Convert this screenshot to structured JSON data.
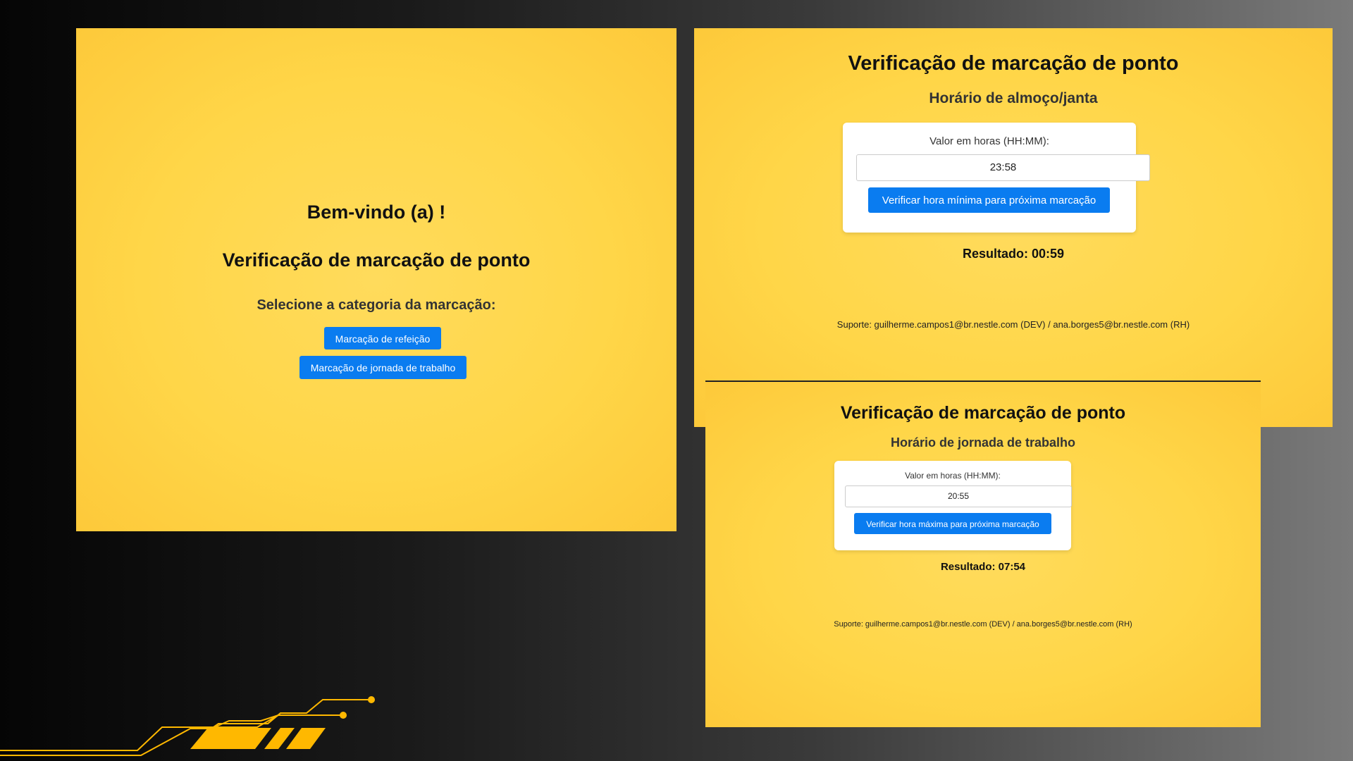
{
  "home": {
    "welcome": "Bem-vindo (a) !",
    "title": "Verificação de marcação de ponto",
    "subtitle": "Selecione a categoria da marcação:",
    "btn_refeicao": "Marcação de refeição",
    "btn_jornada": "Marcação de jornada de trabalho"
  },
  "meal": {
    "title": "Verificação de marcação de ponto",
    "subtitle": "Horário de almoço/janta",
    "label": "Valor em horas (HH:MM):",
    "value": "23:58",
    "button": "Verificar hora mínima para próxima marcação",
    "result": "Resultado: 00:59",
    "support": "Suporte: guilherme.campos1@br.nestle.com (DEV) / ana.borges5@br.nestle.com (RH)"
  },
  "work": {
    "title": "Verificação de marcação de ponto",
    "subtitle": "Horário de jornada de trabalho",
    "label": "Valor em horas (HH:MM):",
    "value": "20:55",
    "button": "Verificar hora máxima para próxima marcação",
    "result": "Resultado: 07:54",
    "support": "Suporte: guilherme.campos1@br.nestle.com (DEV) / ana.borges5@br.nestle.com (RH)"
  },
  "colors": {
    "panel": "#ffd648",
    "button": "#0a7cf0",
    "accent": "#ffb800"
  }
}
